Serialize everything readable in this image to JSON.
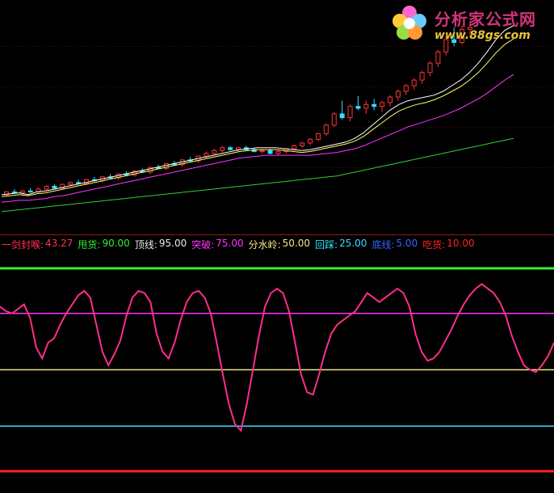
{
  "watermark": {
    "brand": "分析家公式网",
    "url": "www.88gs.com"
  },
  "legend": [
    {
      "name": "一剑封喉",
      "value": "43.27",
      "color": "#ff3355"
    },
    {
      "name": "甩货",
      "value": "90.00",
      "color": "#33ee33"
    },
    {
      "name": "顶线",
      "value": "95.00",
      "color": "#e8e8e8"
    },
    {
      "name": "突破",
      "value": "75.00",
      "color": "#ff33ff"
    },
    {
      "name": "分水岭",
      "value": "50.00",
      "color": "#f0e68c"
    },
    {
      "name": "回踩",
      "value": "25.00",
      "color": "#33ddff"
    },
    {
      "name": "底线",
      "value": "5.00",
      "color": "#3366ff"
    },
    {
      "name": "吃货",
      "value": "10.00",
      "color": "#ff2222"
    }
  ],
  "chart_data": [
    {
      "type": "candlestick",
      "panel": "price",
      "series": [
        {
          "color": "#ffffff",
          "values": [
            240,
            241,
            242,
            240,
            243,
            244,
            246,
            248,
            250,
            252,
            254,
            256,
            258,
            260,
            262,
            264,
            266,
            268,
            270,
            272,
            274,
            276,
            278,
            280,
            282,
            284,
            286,
            288,
            289,
            290,
            290,
            290,
            289,
            288,
            287,
            288,
            290,
            292,
            294,
            296,
            300,
            306,
            314,
            322,
            330,
            336,
            340,
            342,
            344,
            346,
            350,
            356,
            362,
            370,
            380,
            392,
            405,
            415,
            420
          ]
        },
        {
          "color": "#ffff66",
          "values": [
            238,
            239,
            240,
            239,
            241,
            242,
            244,
            246,
            248,
            250,
            252,
            254,
            256,
            258,
            260,
            262,
            264,
            266,
            268,
            270,
            272,
            274,
            276,
            278,
            280,
            282,
            284,
            286,
            287,
            288,
            288,
            288,
            287,
            286,
            285,
            286,
            288,
            290,
            292,
            294,
            297,
            302,
            309,
            316,
            323,
            329,
            333,
            336,
            338,
            341,
            345,
            350,
            355,
            362,
            370,
            380,
            391,
            400,
            406
          ]
        },
        {
          "color": "#ff33ff",
          "values": [
            232,
            233,
            234,
            234,
            235,
            236,
            238,
            239,
            241,
            243,
            245,
            247,
            249,
            251,
            253,
            255,
            257,
            259,
            261,
            263,
            265,
            267,
            269,
            271,
            273,
            275,
            277,
            279,
            280,
            281,
            282,
            282,
            282,
            282,
            282,
            282,
            283,
            284,
            285,
            287,
            289,
            292,
            296,
            300,
            304,
            308,
            312,
            315,
            318,
            321,
            324,
            328,
            332,
            337,
            342,
            348,
            355,
            362,
            368
          ]
        },
        {
          "color": "#33cc33",
          "values": [
            222,
            223,
            224,
            225,
            226,
            227,
            228,
            229,
            230,
            231,
            232,
            233,
            234,
            235,
            236,
            237,
            238,
            239,
            240,
            241,
            242,
            243,
            244,
            245,
            246,
            247,
            248,
            249,
            250,
            251,
            252,
            253,
            254,
            255,
            256,
            257,
            258,
            259,
            260,
            262,
            264,
            266,
            268,
            270,
            272,
            274,
            276,
            278,
            280,
            282,
            284,
            286,
            288,
            290,
            292,
            294,
            296,
            298,
            300
          ]
        }
      ],
      "ohlc": [
        [
          240,
          244,
          239,
          243
        ],
        [
          243,
          246,
          241,
          242
        ],
        [
          242,
          245,
          240,
          244
        ],
        [
          244,
          247,
          242,
          243
        ],
        [
          243,
          248,
          241,
          246
        ],
        [
          246,
          250,
          244,
          249
        ],
        [
          249,
          251,
          246,
          247
        ],
        [
          247,
          252,
          246,
          251
        ],
        [
          251,
          254,
          249,
          253
        ],
        [
          253,
          256,
          251,
          252
        ],
        [
          252,
          257,
          250,
          256
        ],
        [
          256,
          259,
          254,
          255
        ],
        [
          255,
          260,
          253,
          259
        ],
        [
          259,
          262,
          257,
          258
        ],
        [
          258,
          263,
          256,
          262
        ],
        [
          262,
          265,
          260,
          261
        ],
        [
          261,
          266,
          259,
          265
        ],
        [
          265,
          268,
          263,
          264
        ],
        [
          264,
          270,
          262,
          269
        ],
        [
          269,
          272,
          267,
          268
        ],
        [
          268,
          274,
          266,
          273
        ],
        [
          273,
          276,
          271,
          272
        ],
        [
          272,
          278,
          270,
          277
        ],
        [
          277,
          280,
          275,
          276
        ],
        [
          276,
          282,
          274,
          281
        ],
        [
          281,
          286,
          279,
          284
        ],
        [
          284,
          289,
          282,
          287
        ],
        [
          287,
          292,
          285,
          290
        ],
        [
          290,
          292,
          287,
          288
        ],
        [
          288,
          291,
          286,
          290
        ],
        [
          290,
          292,
          287,
          288
        ],
        [
          288,
          290,
          285,
          286
        ],
        [
          286,
          289,
          284,
          287
        ],
        [
          287,
          289,
          283,
          284
        ],
        [
          284,
          287,
          282,
          286
        ],
        [
          286,
          290,
          284,
          289
        ],
        [
          289,
          293,
          287,
          292
        ],
        [
          292,
          296,
          290,
          295
        ],
        [
          295,
          300,
          293,
          299
        ],
        [
          299,
          306,
          297,
          305
        ],
        [
          305,
          316,
          303,
          314
        ],
        [
          314,
          328,
          312,
          326
        ],
        [
          326,
          340,
          320,
          322
        ],
        [
          322,
          336,
          318,
          334
        ],
        [
          334,
          345,
          330,
          332
        ],
        [
          332,
          340,
          326,
          336
        ],
        [
          336,
          342,
          330,
          334
        ],
        [
          334,
          340,
          328,
          338
        ],
        [
          338,
          346,
          334,
          344
        ],
        [
          344,
          352,
          340,
          350
        ],
        [
          350,
          358,
          346,
          356
        ],
        [
          356,
          364,
          352,
          362
        ],
        [
          362,
          372,
          358,
          370
        ],
        [
          370,
          382,
          366,
          380
        ],
        [
          380,
          394,
          376,
          392
        ],
        [
          392,
          408,
          388,
          405
        ],
        [
          405,
          418,
          398,
          402
        ],
        [
          402,
          420,
          400,
          416
        ],
        [
          416,
          424,
          410,
          418
        ]
      ]
    },
    {
      "type": "line",
      "panel": "indicator",
      "ylim": [
        0,
        100
      ],
      "series": [
        {
          "name": "一剑封喉",
          "color": "#ff2d8c",
          "values": [
            78,
            76,
            75,
            77,
            79,
            73,
            60,
            55,
            62,
            64,
            70,
            75,
            79,
            83,
            85,
            82,
            70,
            58,
            52,
            57,
            63,
            74,
            82,
            85,
            84,
            80,
            66,
            58,
            55,
            62,
            72,
            80,
            84,
            85,
            82,
            75,
            62,
            48,
            35,
            26,
            23,
            35,
            50,
            65,
            78,
            84,
            86,
            84,
            76,
            62,
            48,
            40,
            39,
            48,
            58,
            66,
            70,
            72,
            74,
            76,
            80,
            84,
            82,
            80,
            82,
            84,
            86,
            84,
            78,
            66,
            58,
            54,
            55,
            58,
            63,
            68,
            74,
            79,
            83,
            86,
            88,
            86,
            84,
            80,
            74,
            65,
            58,
            52,
            50,
            49,
            52,
            56,
            62
          ]
        }
      ],
      "reference_lines": [
        {
          "name": "顶线",
          "value": 95,
          "color": "#33ee33"
        },
        {
          "name": "突破",
          "value": 75,
          "color": "#ff33ff"
        },
        {
          "name": "分水岭",
          "value": 50,
          "color": "#f0e68c"
        },
        {
          "name": "回踩",
          "value": 25,
          "color": "#33ddff"
        },
        {
          "name": "吃货",
          "value": 5,
          "color": "#ff2222"
        }
      ]
    }
  ]
}
